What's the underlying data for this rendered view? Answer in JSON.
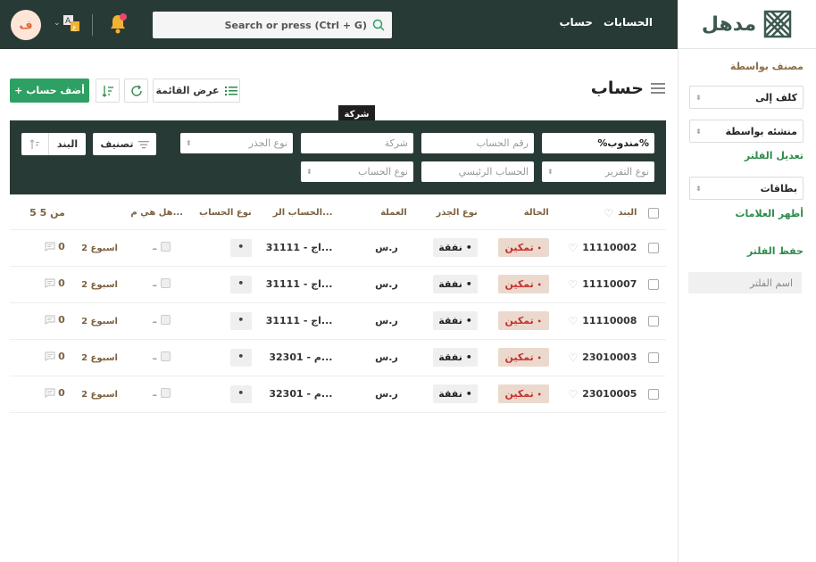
{
  "brand": {
    "name": "مدهل"
  },
  "topnav": {
    "accounts": "الحسابات",
    "account": "حساب"
  },
  "search": {
    "placeholder": "Search or press (Ctrl + G)"
  },
  "user": {
    "initial": "ف"
  },
  "sidebar": {
    "classified_by_label": "مصنف بواسطة",
    "assigned_to": "كلف إلى",
    "created_by": "منشئه بواسطة",
    "edit_filter": "تعديل الفلتر",
    "tags": "بطاقات",
    "show_tags": "أظهر العلامات",
    "save_filter": "حفظ الفلتر",
    "filter_name_placeholder": "اسم الفلتر"
  },
  "toolbar": {
    "title": "حساب",
    "add_label": "أضف حساب",
    "list_view_label": "عرض القائمة"
  },
  "tooltip": "شركة",
  "filters": {
    "percent": "%مندوب%",
    "account_number": "رقم الحساب",
    "company": "شركة",
    "root_type": "نوع الجذر",
    "report_type": "نوع التقرير",
    "parent_account": "الحساب الرئيسي",
    "account_type": "نوع الحساب",
    "sort_label": "تصنيف",
    "item_label": "البند"
  },
  "table": {
    "headers": {
      "item": "البند",
      "status": "الحالة",
      "root_type": "نوع الجذر",
      "currency": "العملة",
      "parent_account": "الحساب الر...",
      "account_type": "نوع الحساب",
      "is_group": "هل هي م...",
      "count": "5 من 5"
    },
    "rows": [
      {
        "code": "11110002",
        "status": "تمكين",
        "root": "نفقة",
        "currency": "ر.س",
        "parent": "31111 - اج...",
        "type": "•",
        "dash": "–",
        "time": "2 اسبوع",
        "comments": "0"
      },
      {
        "code": "11110007",
        "status": "تمكين",
        "root": "نفقة",
        "currency": "ر.س",
        "parent": "31111 - اج...",
        "type": "•",
        "dash": "–",
        "time": "2 اسبوع",
        "comments": "0"
      },
      {
        "code": "11110008",
        "status": "تمكين",
        "root": "نفقة",
        "currency": "ر.س",
        "parent": "31111 - اج...",
        "type": "•",
        "dash": "–",
        "time": "2 اسبوع",
        "comments": "0"
      },
      {
        "code": "23010003",
        "status": "تمكين",
        "root": "نفقة",
        "currency": "ر.س",
        "parent": "32301 - م...",
        "type": "•",
        "dash": "–",
        "time": "2 اسبوع",
        "comments": "0"
      },
      {
        "code": "23010005",
        "status": "تمكين",
        "root": "نفقة",
        "currency": "ر.س",
        "parent": "32301 - م...",
        "type": "•",
        "dash": "–",
        "time": "2 اسبوع",
        "comments": "0"
      }
    ]
  },
  "colors": {
    "topbar": "#283a36",
    "accent": "#2ea063",
    "status_bg": "#ecd9cd",
    "status_fg": "#c6312f"
  }
}
